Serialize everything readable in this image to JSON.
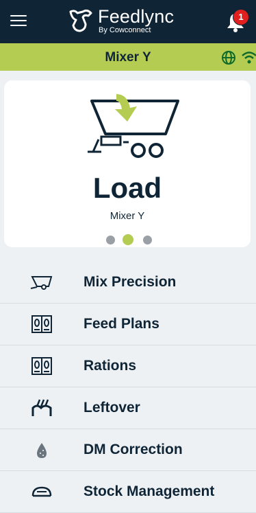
{
  "header": {
    "logo_title": "Feedlync",
    "logo_subtitle": "By Cowconnect",
    "notification_count": "1"
  },
  "subheader": {
    "title": "Mixer Y"
  },
  "card": {
    "title": "Load",
    "subtitle": "Mixer Y",
    "pager": {
      "total": 3,
      "active": 2
    }
  },
  "menu": {
    "items": [
      {
        "label": "Mix Precision",
        "icon": "mixer-icon"
      },
      {
        "label": "Feed Plans",
        "icon": "book-icon"
      },
      {
        "label": "Rations",
        "icon": "book-icon"
      },
      {
        "label": "Leftover",
        "icon": "leftover-icon"
      },
      {
        "label": "DM Correction",
        "icon": "drop-icon"
      },
      {
        "label": "Stock Management",
        "icon": "stock-icon"
      }
    ]
  },
  "colors": {
    "navy": "#0f2536",
    "accent_green": "#b4cc52",
    "badge_red": "#e0201f"
  }
}
